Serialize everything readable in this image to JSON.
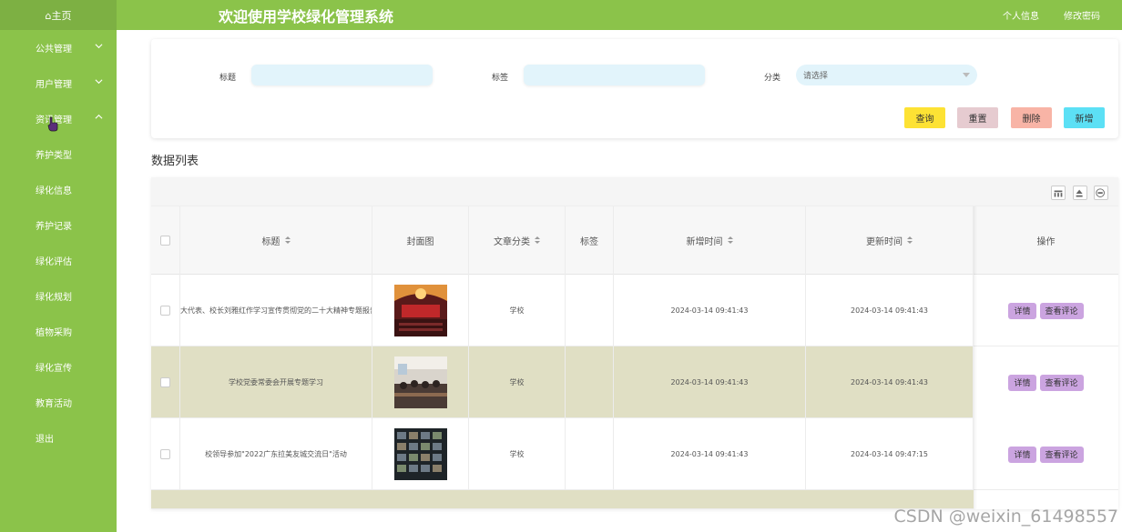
{
  "sidebar": {
    "home": "⌂主页",
    "menus": [
      {
        "label": "公共管理",
        "expanded": false
      },
      {
        "label": "用户管理",
        "expanded": false
      },
      {
        "label": "资讯管理",
        "expanded": true
      }
    ],
    "submenus": [
      "养护类型",
      "绿化信息",
      "养护记录",
      "绿化评估",
      "绿化规划",
      "植物采购",
      "绿化宣传",
      "教育活动",
      "退出"
    ]
  },
  "header": {
    "title": "欢迎使用学校绿化管理系统",
    "profile_link": "个人信息",
    "password_link": "修改密码"
  },
  "search": {
    "title_label": "标题",
    "title_value": "",
    "tag_label": "标签",
    "tag_value": "",
    "category_label": "分类",
    "category_placeholder": "请选择",
    "buttons": {
      "query": "查询",
      "reset": "重置",
      "delete": "删除",
      "add": "新增"
    }
  },
  "list": {
    "section_title": "数据列表",
    "columns": {
      "title": "标题",
      "cover": "封面图",
      "category": "文章分类",
      "tag": "标签",
      "created": "新增时间",
      "updated": "更新时间",
      "actions": "操作"
    },
    "rows": [
      {
        "title": "大代表、校长刘雅红作学习宣传贯彻党的二十大精神专题报告",
        "category": "学校",
        "tag": "",
        "created": "2024-03-14 09:41:43",
        "updated": "2024-03-14 09:41:43",
        "detail": "详情",
        "comments": "查看评论"
      },
      {
        "title": "学校党委常委会开展专题学习",
        "category": "学校",
        "tag": "",
        "created": "2024-03-14 09:41:43",
        "updated": "2024-03-14 09:41:43",
        "detail": "详情",
        "comments": "查看评论"
      },
      {
        "title": "校领导参加\"2022广东拉美友城交流日\"活动",
        "category": "学校",
        "tag": "",
        "created": "2024-03-14 09:41:43",
        "updated": "2024-03-14 09:47:15",
        "detail": "详情",
        "comments": "查看评论"
      }
    ]
  },
  "watermark": "CSDN @weixin_61498557",
  "colors": {
    "brand_green": "#8bc34a",
    "row_highlight": "#e0dfc4",
    "query": "#fde234",
    "reset": "#e6cbd0",
    "delete": "#f8b4a6",
    "add": "#5ce0f5",
    "op_button": "#cba4e0"
  }
}
